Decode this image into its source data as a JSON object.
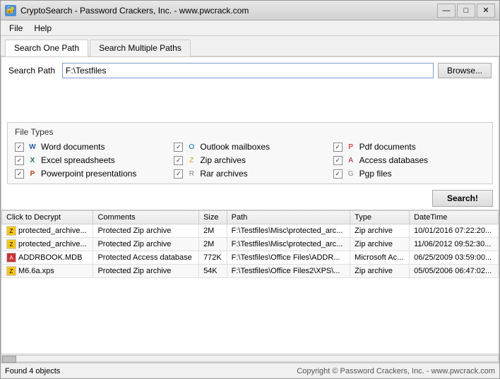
{
  "window": {
    "title": "CryptoSearch - Password Crackers, Inc. - www.pwcrack.com",
    "icon": "🔐"
  },
  "titlebar_buttons": {
    "minimize": "—",
    "maximize": "□",
    "close": "✕"
  },
  "menu": {
    "items": [
      "File",
      "Help"
    ]
  },
  "tabs": [
    {
      "id": "one-path",
      "label": "Search One Path",
      "active": true
    },
    {
      "id": "multiple-paths",
      "label": "Search Multiple Paths",
      "active": false
    }
  ],
  "search_path": {
    "label": "Search Path",
    "value": "F:\\Testfiles",
    "browse_label": "Browse..."
  },
  "file_types": {
    "title": "File Types",
    "items": [
      {
        "checked": true,
        "icon": "W",
        "icon_class": "icon-word",
        "label": "Word documents"
      },
      {
        "checked": true,
        "icon": "X",
        "icon_class": "icon-excel",
        "label": "Excel spreadsheets"
      },
      {
        "checked": true,
        "icon": "P",
        "icon_class": "icon-ppt",
        "label": "Powerpoint presentations"
      },
      {
        "checked": true,
        "icon": "O",
        "icon_class": "icon-outlook",
        "label": "Outlook mailboxes"
      },
      {
        "checked": true,
        "icon": "Z",
        "icon_class": "icon-zip",
        "label": "Zip archives"
      },
      {
        "checked": true,
        "icon": "R",
        "icon_class": "icon-rar",
        "label": "Rar archives"
      },
      {
        "checked": true,
        "icon": "P",
        "icon_class": "icon-pdf",
        "label": "Pdf documents"
      },
      {
        "checked": true,
        "icon": "A",
        "icon_class": "icon-access",
        "label": "Access databases"
      },
      {
        "checked": true,
        "icon": "G",
        "icon_class": "icon-pgp",
        "label": "Pgp files"
      }
    ]
  },
  "search_button_label": "Search!",
  "table": {
    "columns": [
      "Click to Decrypt",
      "Comments",
      "Size",
      "Path",
      "Type",
      "DateTime"
    ],
    "rows": [
      {
        "icon": "zip",
        "name": "protected_archive...",
        "comments": "Protected Zip archive",
        "size": "2M",
        "path": "F:\\Testfiles\\Misc\\protected_arc...",
        "type": "Zip archive",
        "datetime": "10/01/2016 07:22:20..."
      },
      {
        "icon": "zip",
        "name": "protected_archive...",
        "comments": "Protected Zip archive",
        "size": "2M",
        "path": "F:\\Testfiles\\Misc\\protected_arc...",
        "type": "Zip archive",
        "datetime": "11/06/2012 09:52:30..."
      },
      {
        "icon": "mdb",
        "name": "ADDRBOOK.MDB",
        "comments": "Protected Access database",
        "size": "772K",
        "path": "F:\\Testfiles\\Office Files\\ADDR...",
        "type": "Microsoft Ac...",
        "datetime": "06/25/2009 03:59:00..."
      },
      {
        "icon": "zip",
        "name": "M6.6a.xps",
        "comments": "Protected Zip archive",
        "size": "54K",
        "path": "F:\\Testfiles\\Office Files2\\XPS\\...",
        "type": "Zip archive",
        "datetime": "05/05/2006 06:47:02..."
      }
    ]
  },
  "status": {
    "left": "Found 4 objects",
    "right": "Copyright © Password Crackers, Inc. - www.pwcrack.com"
  }
}
